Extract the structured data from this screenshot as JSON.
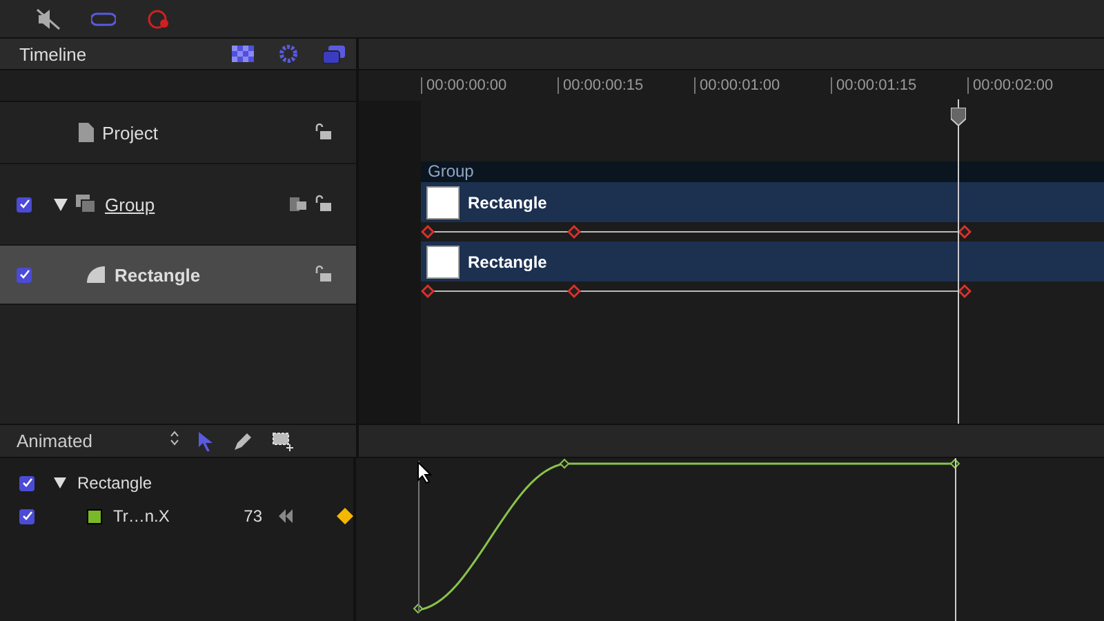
{
  "panel": {
    "title": "Timeline"
  },
  "layers": [
    {
      "name": "Project",
      "kind": "project",
      "selected": false
    },
    {
      "name": "Group",
      "kind": "group",
      "checked": true,
      "expanded": true,
      "selected": false
    },
    {
      "name": "Rectangle",
      "kind": "shape",
      "checked": true,
      "selected": true
    }
  ],
  "ruler": [
    "00:00:00:00",
    "00:00:00:15",
    "00:00:01:00",
    "00:00:01:15",
    "00:00:02:00"
  ],
  "tracks": {
    "group_label": "Group",
    "clips": [
      "Rectangle",
      "Rectangle"
    ]
  },
  "curve_editor": {
    "filter": "Animated",
    "tree": [
      {
        "name": "Rectangle",
        "checked": true,
        "expanded": true,
        "children": [
          {
            "name": "Tr…n.X",
            "checked": true,
            "value": "73",
            "color": "#7ab829"
          }
        ]
      }
    ]
  }
}
